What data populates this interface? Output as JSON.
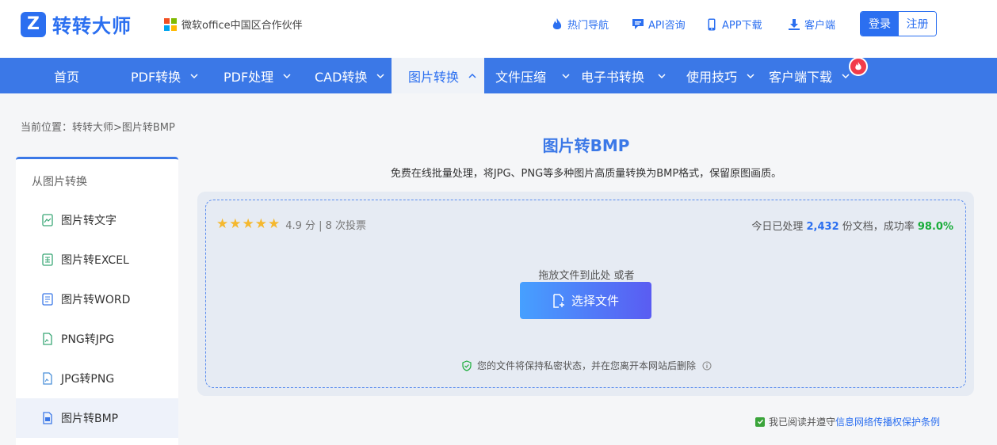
{
  "header": {
    "logo_mark": "Z",
    "logo_text": "转转大师",
    "partner_text": "微软office中国区合作伙伴",
    "links": [
      {
        "label": "热门导航",
        "icon": "fire-icon"
      },
      {
        "label": "API咨询",
        "icon": "chat-icon"
      },
      {
        "label": "APP下载",
        "icon": "phone-icon"
      },
      {
        "label": "客户端",
        "icon": "download-icon"
      }
    ],
    "login_label": "登录",
    "register_label": "注册"
  },
  "nav": {
    "items": [
      {
        "label": "首页",
        "has_dropdown": false
      },
      {
        "label": "PDF转换",
        "has_dropdown": true
      },
      {
        "label": "PDF处理",
        "has_dropdown": true
      },
      {
        "label": "CAD转换",
        "has_dropdown": true
      },
      {
        "label": "图片转换",
        "has_dropdown": true,
        "active": true
      },
      {
        "label": "文件压缩",
        "has_dropdown": true
      },
      {
        "label": "电子书转换",
        "has_dropdown": true
      },
      {
        "label": "使用技巧",
        "has_dropdown": true
      },
      {
        "label": "客户端下载",
        "has_dropdown": true
      }
    ]
  },
  "breadcrumb": "当前位置：转转大师>图片转BMP",
  "sidebar": {
    "title": "从图片转换",
    "items": [
      {
        "label": "图片转文字"
      },
      {
        "label": "图片转EXCEL"
      },
      {
        "label": "图片转WORD"
      },
      {
        "label": "PNG转JPG"
      },
      {
        "label": "JPG转PNG"
      },
      {
        "label": "图片转BMP",
        "active": true
      }
    ]
  },
  "main": {
    "title": "图片转BMP",
    "subtitle": "免费在线批量处理，将JPG、PNG等多种图片高质量转换为BMP格式，保留原图画质。",
    "rating": {
      "stars": "★★★★★",
      "text": "4.9 分 | 8 次投票"
    },
    "stats": {
      "prefix": "今日已处理 ",
      "count": "2,432",
      "middle": " 份文档，成功率 ",
      "rate": "98.0%"
    },
    "drop_hint": "拖放文件到此处 或者",
    "choose_label": "选择文件",
    "privacy_text": "您的文件将保持私密状态，并在您离开本网站后删除",
    "agree_prefix": "我已阅读并遵守",
    "agree_link": "信息网络传播权保护条例"
  },
  "colors": {
    "brand": "#2b6ff0",
    "nav_bg": "#3b78e7",
    "success": "#1aad3a",
    "hot": "#f23b4a"
  }
}
